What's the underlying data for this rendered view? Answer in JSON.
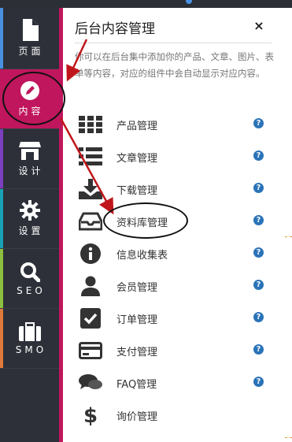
{
  "sidebar": {
    "items": [
      {
        "label": "页面",
        "icon": "page-icon",
        "accent": "#4a90e2",
        "active": false
      },
      {
        "label": "内容",
        "icon": "pencil-icon",
        "accent": "#c0165d",
        "active": true
      },
      {
        "label": "设计",
        "icon": "store-icon",
        "accent": "#7b3fbf",
        "active": false
      },
      {
        "label": "设置",
        "icon": "gear-icon",
        "accent": "#1aa1b5",
        "active": false
      },
      {
        "label": "SEO",
        "icon": "search-icon",
        "accent": "#8cbf3f",
        "active": false
      },
      {
        "label": "SMO",
        "icon": "briefcase-icon",
        "accent": "#e07a3a",
        "active": false
      }
    ]
  },
  "panel": {
    "title": "后台内容管理",
    "close": "×",
    "description": "你可以在后台集中添加你的产品、文章、图片、表单等内容，对应的组件中会自动显示对应内容。",
    "items": [
      {
        "label": "产品管理",
        "icon": "grid-icon",
        "help": "?"
      },
      {
        "label": "文章管理",
        "icon": "list-icon",
        "help": "?"
      },
      {
        "label": "下载管理",
        "icon": "download-icon",
        "help": "?"
      },
      {
        "label": "资料库管理",
        "icon": "inbox-icon",
        "help": "?"
      },
      {
        "label": "信息收集表",
        "icon": "info-icon",
        "help": "?"
      },
      {
        "label": "会员管理",
        "icon": "user-icon",
        "help": "?"
      },
      {
        "label": "订单管理",
        "icon": "checkbox-icon",
        "help": "?"
      },
      {
        "label": "支付管理",
        "icon": "credit-card-icon",
        "help": "?"
      },
      {
        "label": "FAQ管理",
        "icon": "comments-icon",
        "help": "?"
      },
      {
        "label": "询价管理",
        "icon": "dollar-icon",
        "help": ""
      }
    ]
  },
  "colors": {
    "active": "#c0165d",
    "sidebar": "#2d3039",
    "help": "#2a73b8",
    "annotation": "#c0161b"
  }
}
